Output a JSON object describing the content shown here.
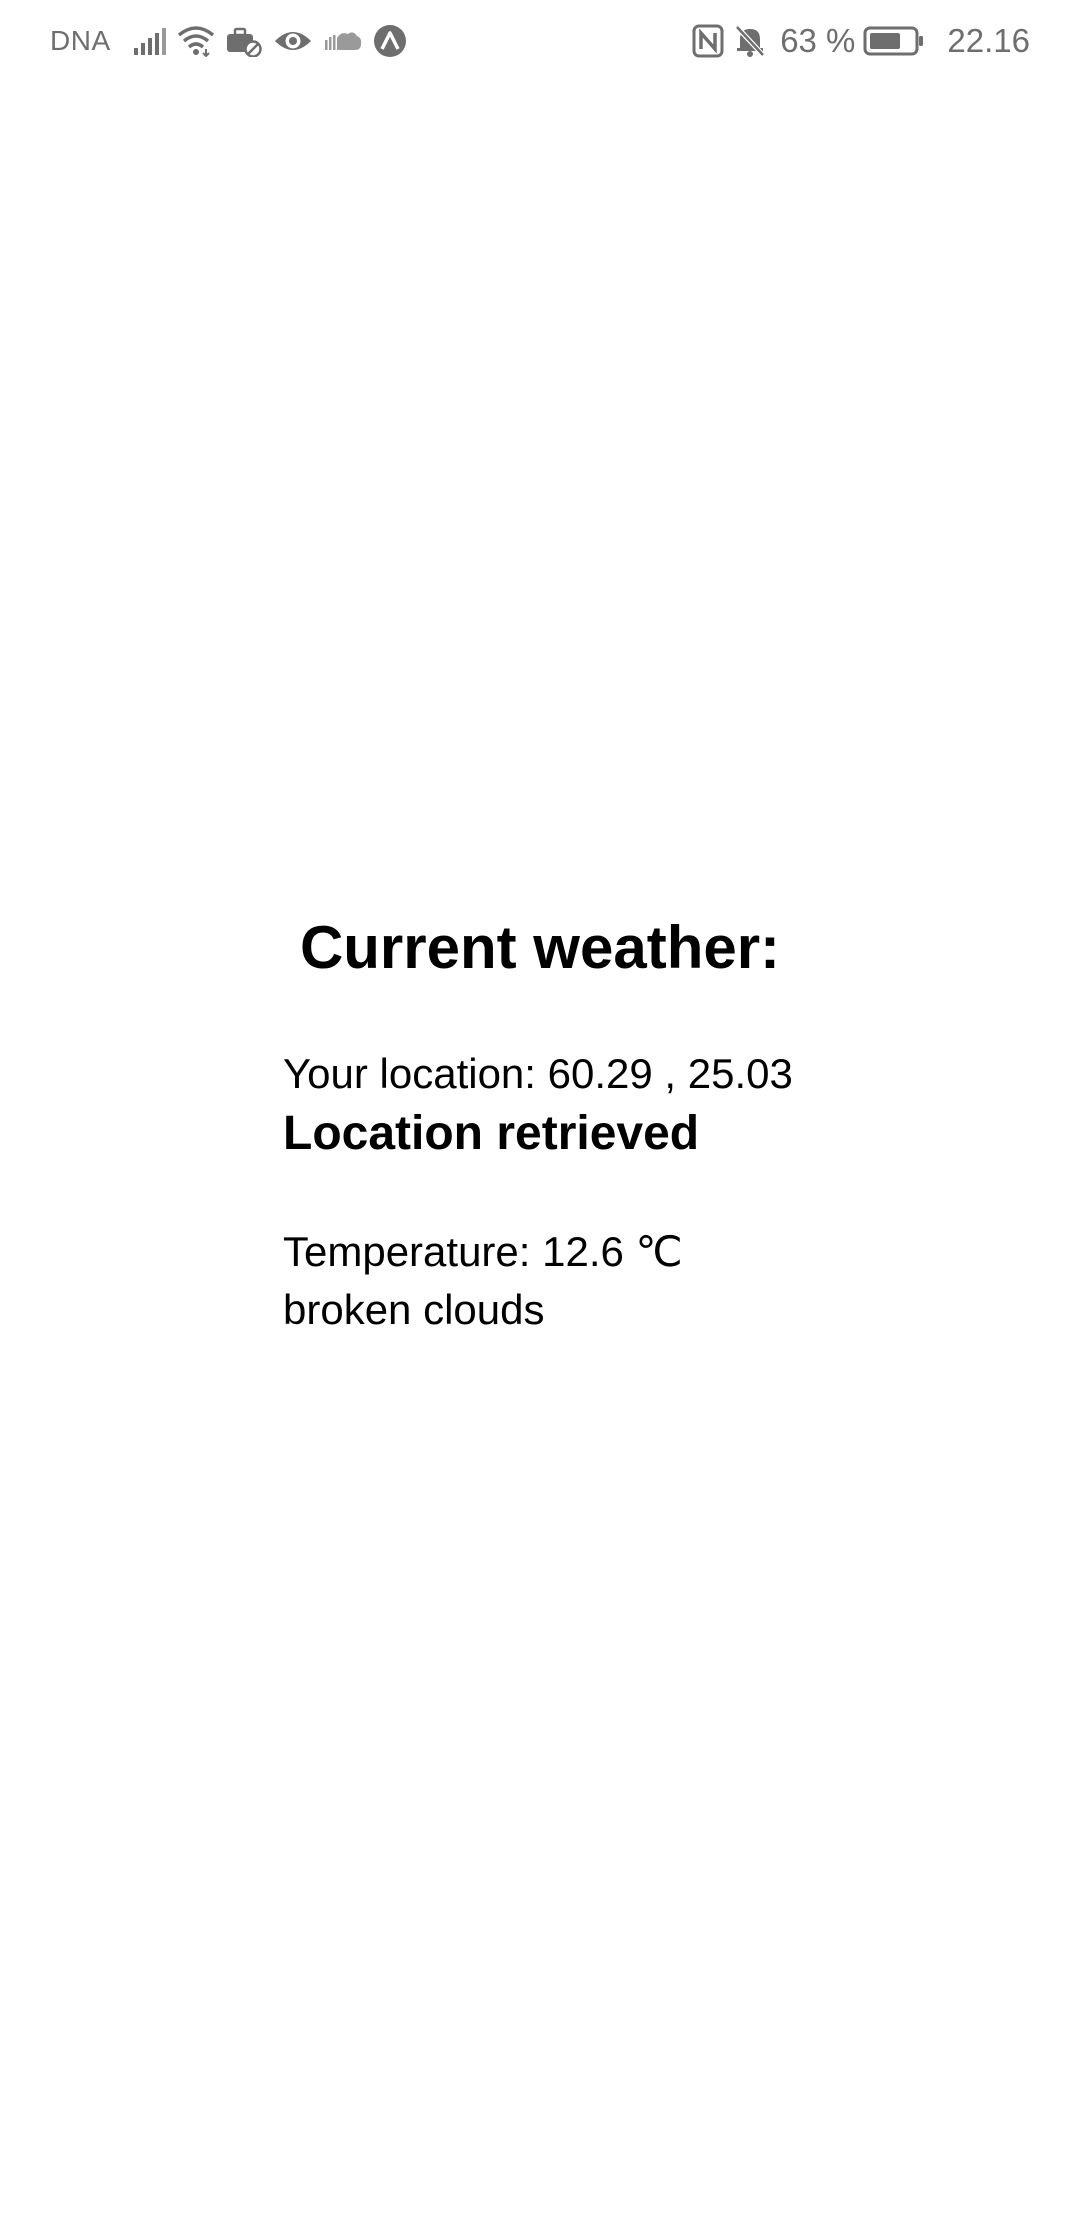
{
  "status_bar": {
    "carrier": "DNA",
    "battery_percent": "63 %",
    "time": "22.16",
    "left_icons": [
      "signal-bars-icon",
      "wifi-icon",
      "work-profile-icon",
      "eye-comfort-icon",
      "cloud-icon",
      "app-notification-icon"
    ],
    "right_icons": [
      "nfc-icon",
      "muted-bell-icon",
      "battery-icon"
    ],
    "icon_color": "#6e6e6e"
  },
  "weather": {
    "title": "Current weather:",
    "location_label": "Your location:",
    "latitude": "60.29",
    "longitude": "25.03",
    "location_status": "Location retrieved",
    "temperature_label": "Temperature:",
    "temperature_value": "12.6",
    "temperature_unit": "℃",
    "description": "broken clouds"
  },
  "colors": {
    "background": "#ffffff",
    "text": "#000000",
    "status_text": "#6e6e6e"
  }
}
